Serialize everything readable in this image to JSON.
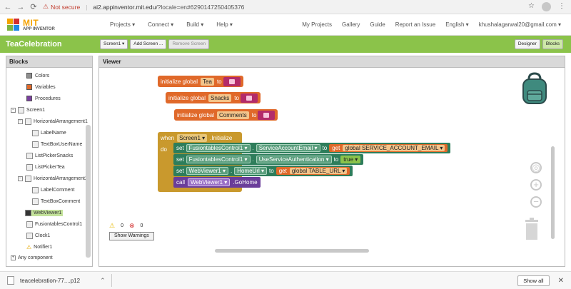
{
  "browser": {
    "security": "Not secure",
    "url_host": "ai2.appinventor.mit.edu",
    "url_rest": "/?locale=en#6290147250405376"
  },
  "logo": {
    "mit": "MIT",
    "sub": "APP INVENTOR"
  },
  "menu": [
    "Projects ▾",
    "Connect ▾",
    "Build ▾",
    "Help ▾"
  ],
  "menu_right": [
    "My Projects",
    "Gallery",
    "Guide",
    "Report an Issue",
    "English ▾",
    "khushalagarwal20@gmail.com ▾"
  ],
  "project": {
    "name": "TeaCelebration",
    "screen_btn": "Screen1 ▾",
    "add_screen": "Add Screen ...",
    "remove_screen": "Remove Screen",
    "designer": "Designer",
    "blocks": "Blocks"
  },
  "blocks_panel": {
    "title": "Blocks",
    "builtins": [
      {
        "label": "Colors",
        "color": "#8f8f8f"
      },
      {
        "label": "Variables",
        "color": "#e0692a"
      },
      {
        "label": "Procedures",
        "color": "#7a3f9e"
      }
    ],
    "tree": [
      "Screen1",
      "HorizontalArrangement1",
      "LabelName",
      "TextBoxUserName",
      "ListPickerSnacks",
      "ListPickerTea",
      "HorizontalArrangement2",
      "LabelComment",
      "TextBoxComment",
      "WebViewer1",
      "FusiontablesControl1",
      "Clock1",
      "Notifier1",
      "Any component"
    ]
  },
  "viewer": {
    "title": "Viewer",
    "globals": [
      {
        "prefix": "initialize global",
        "name": "Tea",
        "to": "to"
      },
      {
        "prefix": "initialize global",
        "name": "Snacks",
        "to": "to"
      },
      {
        "prefix": "initialize global",
        "name": "Comments",
        "to": "to"
      }
    ],
    "event": {
      "when": "when",
      "component": "Screen1 ▾",
      "event_name": ".Initialize",
      "do": "do"
    },
    "stmt1": {
      "set": "set",
      "component": "FusiontablesControl1 ▾",
      "prop": "ServiceAccountEmail ▾",
      "to": "to",
      "get": "get",
      "var": "global SERVICE_ACCOUNT_EMAIL ▾"
    },
    "stmt2": {
      "set": "set",
      "component": "FusiontablesControl1 ▾",
      "prop": "UseServiceAuthentication ▾",
      "to": "to",
      "value": "true ▾"
    },
    "stmt3": {
      "set": "set",
      "component": "WebViewer1 ▾",
      "prop": "HomeUrl ▾",
      "to": "to",
      "get": "get",
      "var": "global TABLE_URL ▾"
    },
    "stmt4": {
      "call": "call",
      "component": "WebViewer1 ▾",
      "method": ".GoHome"
    },
    "warnings_count": "0",
    "errors_count": "0",
    "show_warnings": "Show Warnings"
  },
  "download": {
    "file": "teacelebration-77....p12",
    "show_all": "Show all"
  }
}
